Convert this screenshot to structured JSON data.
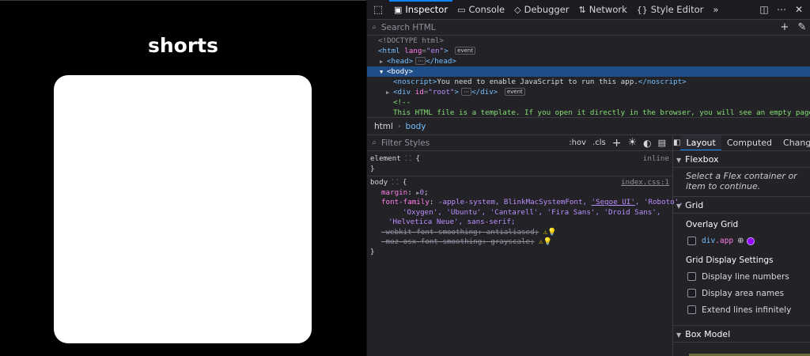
{
  "page": {
    "heading": "shorts"
  },
  "devtools": {
    "tabs": [
      {
        "label": "Inspector",
        "icon": "inspector-icon"
      },
      {
        "label": "Console",
        "icon": "console-icon"
      },
      {
        "label": "Debugger",
        "icon": "debugger-icon"
      },
      {
        "label": "Network",
        "icon": "network-icon"
      },
      {
        "label": "Style Editor",
        "icon": "style-editor-icon"
      }
    ],
    "search_placeholder": "Search HTML",
    "markup": {
      "doctype": "<!DOCTYPE html>",
      "html_tag": "html",
      "html_attr": "lang",
      "html_val": "\"en\"",
      "event_badge": "event",
      "head_tag": "<head>",
      "head_close": "</head>",
      "body_tag": "<body>",
      "noscript_open": "<noscript>",
      "noscript_text": "You need to enable JavaScript to run this app.",
      "noscript_close": "</noscript>",
      "div_open": "div",
      "div_attr": "id",
      "div_val": "\"root\"",
      "div_close": "</div>",
      "comment_open": "<!--",
      "comment_text": "This HTML file is a template. If you open it directly in the browser, you will see an empty page. You can ad"
    },
    "breadcrumb": [
      "html",
      "body"
    ],
    "rules": {
      "filter_placeholder": "Filter Styles",
      "hov": ":hov",
      "cls": ".cls",
      "element_selector": "element",
      "element_source": "inline",
      "body_selector": "body",
      "body_source": "index.css:1",
      "margin_prop": "margin",
      "margin_val": "0",
      "font_prop": "font-family",
      "font_val_1": "-apple-system, BlinkMacSystemFont, ",
      "font_val_segoe": "'Segoe UI'",
      "font_val_roboto": ", 'Roboto',",
      "font_val_2": "'Oxygen', 'Ubuntu', 'Cantarell', 'Fira Sans', 'Droid Sans',",
      "font_val_3": "'Helvetica Neue', sans-serif;",
      "webkit_prop": "-webkit-font-smoothing: antialiased;",
      "moz_prop": "-moz-osx-font-smoothing: grayscale;"
    },
    "sidebar": {
      "tabs": [
        "Layout",
        "Computed",
        "Changes"
      ],
      "flexbox_title": "Flexbox",
      "flexbox_note": "Select a Flex container or item to continue.",
      "grid_title": "Grid",
      "overlay_grid_title": "Overlay Grid",
      "grid_item_tag": "div",
      "grid_item_class": ".app",
      "overlay_color": "#9400ff",
      "display_settings_title": "Grid Display Settings",
      "options": [
        "Display line numbers",
        "Display area names",
        "Extend lines infinitely"
      ],
      "box_model_title": "Box Model"
    }
  }
}
